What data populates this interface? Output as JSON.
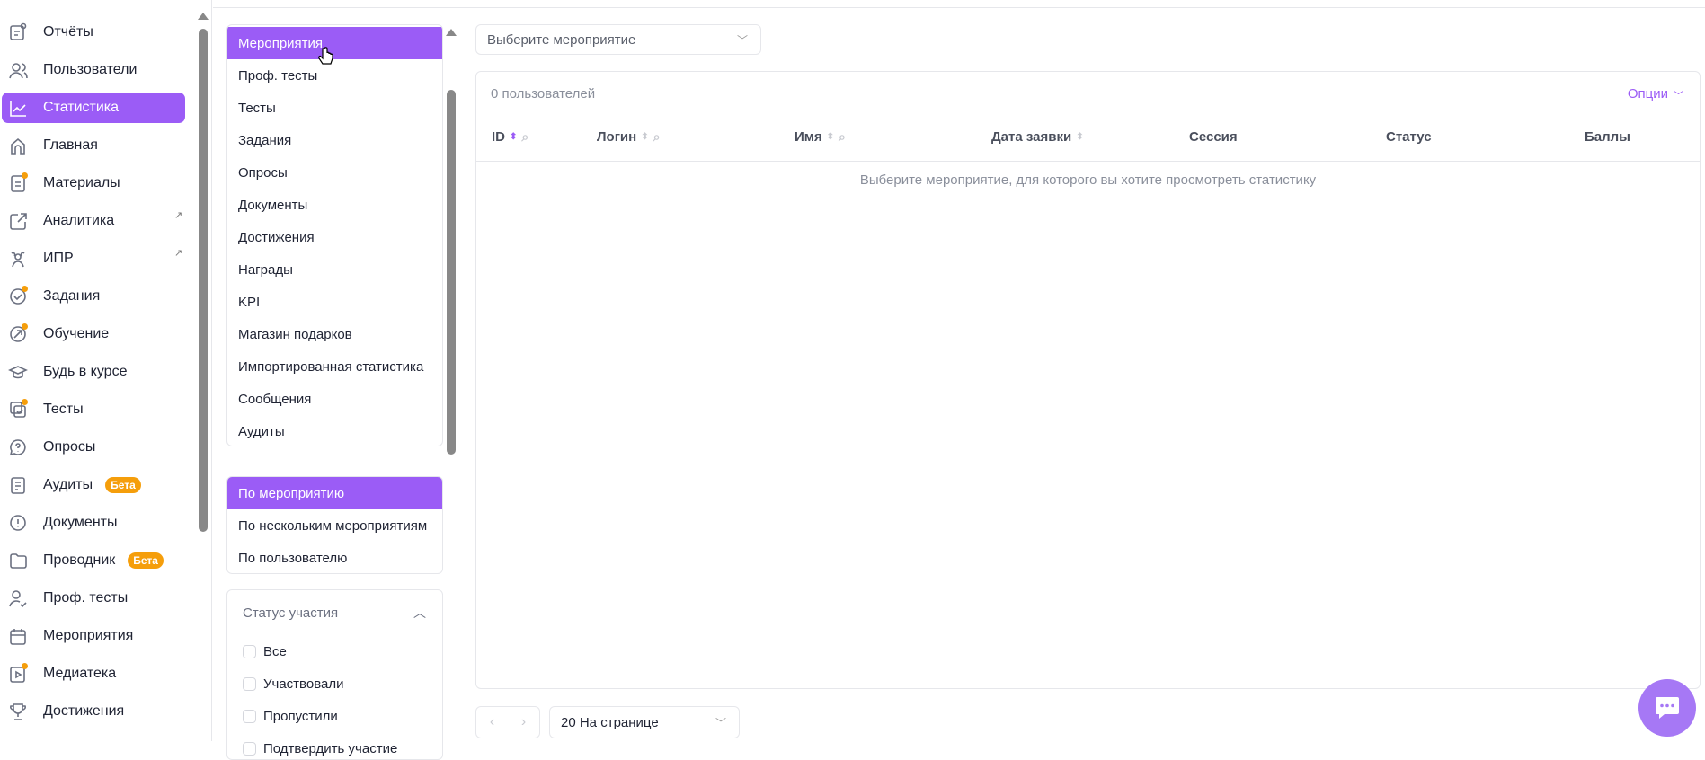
{
  "sidebar": {
    "items": [
      {
        "label": "Отчёты",
        "icon": "report-icon"
      },
      {
        "label": "Пользователи",
        "icon": "users-icon"
      },
      {
        "label": "Статистика",
        "icon": "chart-line-icon",
        "active": true
      },
      {
        "label": "Главная",
        "icon": "home-icon"
      },
      {
        "label": "Материалы",
        "icon": "document-icon",
        "dot": true
      },
      {
        "label": "Аналитика",
        "icon": "external-link-icon",
        "external": "↗"
      },
      {
        "label": "ИПР",
        "icon": "team-icon",
        "external": "↗"
      },
      {
        "label": "Задания",
        "icon": "check-circle-icon",
        "dot": true
      },
      {
        "label": "Обучение",
        "icon": "learning-icon",
        "dot": true
      },
      {
        "label": "Будь в курсе",
        "icon": "graduation-cap-icon"
      },
      {
        "label": "Тесты",
        "icon": "tests-icon",
        "dot": true
      },
      {
        "label": "Опросы",
        "icon": "question-bubble-icon"
      },
      {
        "label": "Аудиты",
        "icon": "audit-icon",
        "badge": "Бета"
      },
      {
        "label": "Документы",
        "icon": "exclamation-circle-icon"
      },
      {
        "label": "Проводник",
        "icon": "folder-icon",
        "badge": "Бета"
      },
      {
        "label": "Проф. тесты",
        "icon": "user-check-icon"
      },
      {
        "label": "Мероприятия",
        "icon": "calendar-icon"
      },
      {
        "label": "Медиатека",
        "icon": "media-icon",
        "dot": true
      },
      {
        "label": "Достижения",
        "icon": "trophy-icon"
      }
    ]
  },
  "category_menu": [
    "Мероприятия",
    "Проф. тесты",
    "Тесты",
    "Задания",
    "Опросы",
    "Документы",
    "Достижения",
    "Награды",
    "KPI",
    "Магазин подарков",
    "Импортированная статистика",
    "Сообщения",
    "Аудиты"
  ],
  "mode_menu": [
    "По мероприятию",
    "По нескольким мероприятиям",
    "По пользователю"
  ],
  "status_filter": {
    "title": "Статус участия",
    "options": [
      "Все",
      "Участвовали",
      "Пропустили",
      "Подтвердить участие"
    ]
  },
  "main": {
    "event_select_placeholder": "Выберите мероприятие",
    "user_count": "0 пользователей",
    "options_label": "Опции",
    "columns": [
      "ID",
      "Логин",
      "Имя",
      "Дата заявки",
      "Сессия",
      "Статус",
      "Баллы"
    ],
    "empty_message": "Выберите мероприятие, для которого вы хотите просмотреть статистику",
    "per_page": "20 На странице"
  },
  "colors": {
    "accent": "#9b5cf6",
    "badge": "#f59e0b"
  }
}
